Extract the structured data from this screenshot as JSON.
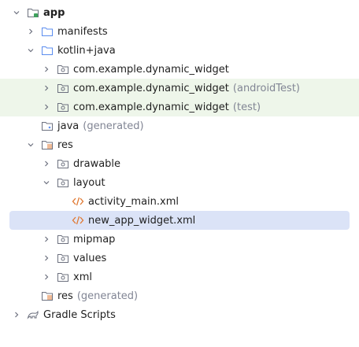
{
  "tree": {
    "app": "app",
    "manifests": "manifests",
    "kotlin_java": "kotlin+java",
    "pkg1": "com.example.dynamic_widget",
    "pkg2": "com.example.dynamic_widget",
    "pkg2_suffix": "(androidTest)",
    "pkg3": "com.example.dynamic_widget",
    "pkg3_suffix": "(test)",
    "java": "java",
    "java_suffix": "(generated)",
    "res": "res",
    "drawable": "drawable",
    "layout": "layout",
    "activity_main": "activity_main.xml",
    "new_app_widget": "new_app_widget.xml",
    "mipmap": "mipmap",
    "values": "values",
    "xml": "xml",
    "res_gen": "res",
    "res_gen_suffix": "(generated)",
    "gradle": "Gradle Scripts"
  },
  "colors": {
    "accent_folder": "#5b8def",
    "res_icon": "#e0772f",
    "green_row": "#eef6ea",
    "selected_row": "#dbe3f7"
  }
}
